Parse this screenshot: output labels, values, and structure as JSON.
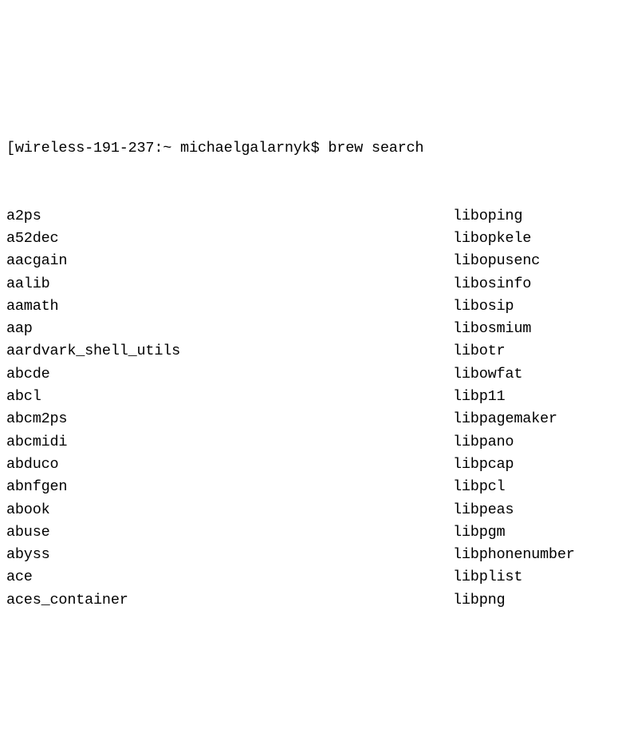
{
  "prompt": {
    "bracket": "[",
    "host": "wireless-191-237",
    "colon": ":",
    "path": "~",
    "user": " michaelgalarnyk",
    "dollar": "$",
    "command": " brew search"
  },
  "left_column": [
    "a2ps",
    "a52dec",
    "aacgain",
    "aalib",
    "aamath",
    "aap",
    "aardvark_shell_utils",
    "abcde",
    "abcl",
    "abcm2ps",
    "abcmidi",
    "abduco",
    "abnfgen",
    "abook",
    "abuse",
    "abyss",
    "ace",
    "aces_container"
  ],
  "right_column": [
    "liboping",
    "libopkele",
    "libopusenc",
    "libosinfo",
    "libosip",
    "libosmium",
    "libotr",
    "libowfat",
    "libp11",
    "libpagemaker",
    "libpano",
    "libpcap",
    "libpcl",
    "libpeas",
    "libpgm",
    "libphonenumber",
    "libplist",
    "libpng"
  ]
}
